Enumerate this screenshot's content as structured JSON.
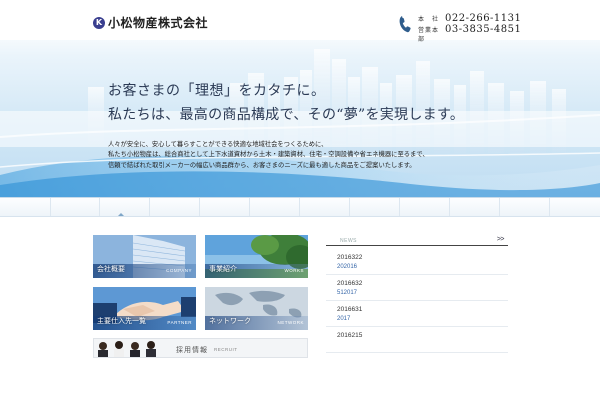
{
  "header": {
    "logo_mark": "K",
    "company_name": "小松物産株式会社",
    "contacts": [
      {
        "label": "本　社",
        "number": "022-266-1131"
      },
      {
        "label": "営業本部",
        "number": "03-3835-4851"
      }
    ]
  },
  "hero": {
    "headline_line1": "お客さまの「理想」をカタチに。",
    "headline_line2": "私たちは、最高の商品構成で、その“夢”を実現します。",
    "description": [
      "人々が安全に、安心して暮らすことができる快適な地域社会をつくるために、",
      "私たち小松物産は、総合商社として上下水道資材から土木・建築資材、住宅・空調設備や省エネ機器に至るまで、",
      "信頼で結ばれた取引メーカーの幅広い商品群から、お客さまのニーズに最も適した商品をご提案いたします。"
    ]
  },
  "tiles": [
    {
      "title": "会社概要",
      "sub": "COMPANY"
    },
    {
      "title": "事業紹介",
      "sub": "WORKS"
    },
    {
      "title": "主要仕入先一覧",
      "sub": "PARTNER"
    },
    {
      "title": "ネットワーク",
      "sub": "NETWORK"
    }
  ],
  "recruit": {
    "title": "採用情報",
    "sub": "RECRUIT"
  },
  "news": {
    "title": "NEWS",
    "more": ">>",
    "items": [
      {
        "date": "2016322",
        "text": "202016"
      },
      {
        "date": "2016632",
        "text": "512017"
      },
      {
        "date": "2016631",
        "text": "2017"
      },
      {
        "date": "2016215",
        "text": ""
      }
    ]
  },
  "colors": {
    "accent": "#3566a8",
    "logo": "#3a3f8f",
    "phone_icon": "#2f5d8c"
  },
  "icons": {
    "phone": "phone-icon",
    "logo_mark": "logo-k-icon"
  }
}
